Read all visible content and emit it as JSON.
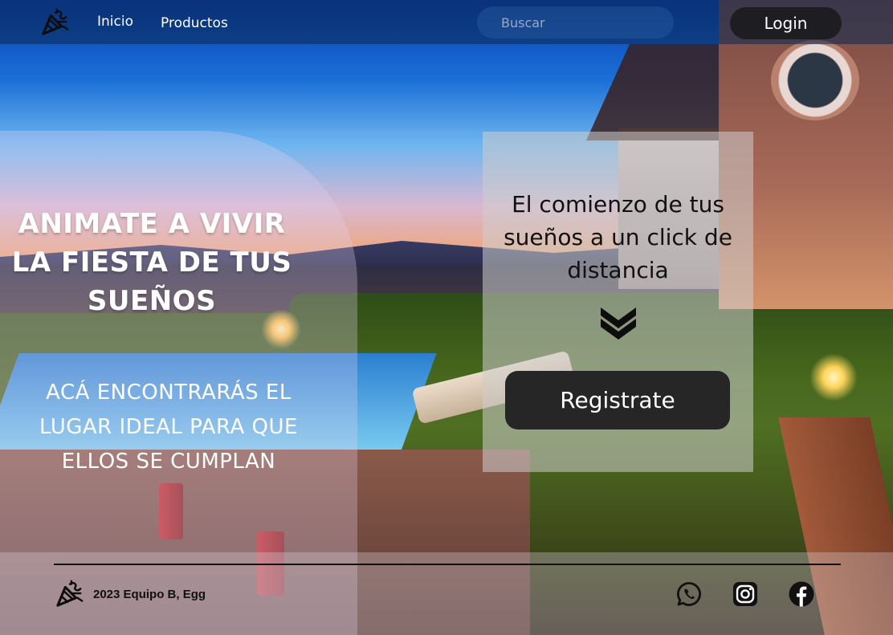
{
  "nav": {
    "links": [
      "Inicio",
      "Productos"
    ],
    "search_placeholder": "Buscar",
    "login_label": "Login"
  },
  "hero": {
    "title_lines": [
      "ANIMATE A VIVIR",
      "LA FIESTA DE TUS",
      "SUEÑOS"
    ],
    "subtitle_lines": [
      "ACÁ ENCONTRARÁS EL",
      "LUGAR IDEAL PARA QUE",
      "ELLOS SE CUMPLAN"
    ]
  },
  "cta": {
    "text_lines": [
      "El comienzo de tus",
      "sueños a un click de",
      "distancia"
    ],
    "register_label": "Registrate",
    "arrow_icon": "double-chevron-down-icon"
  },
  "footer": {
    "copyright": "2023 Equipo B, Egg",
    "social_icons": [
      "whatsapp-icon",
      "instagram-icon",
      "facebook-icon"
    ]
  },
  "colors": {
    "nav_bg": "#0a2850",
    "button_dark": "#1e1e22",
    "card_bg": "#cdcdcd",
    "text_light": "#ffffff",
    "text_dark": "#111111"
  }
}
